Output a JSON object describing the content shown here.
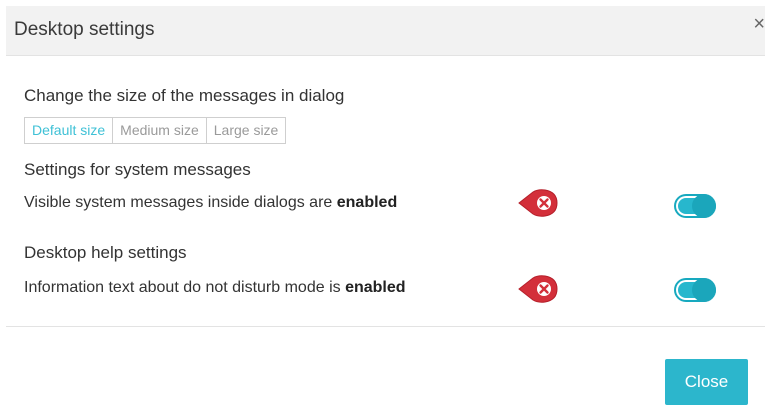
{
  "dialog": {
    "title": "Desktop settings",
    "close_icon_glyph": "×"
  },
  "message_size": {
    "title": "Change the size of the messages in dialog",
    "options": [
      "Default size",
      "Medium size",
      "Large size"
    ],
    "selected": "Default size"
  },
  "system_messages": {
    "title": "Settings for system messages",
    "text_prefix": "Visible system messages inside dialogs are",
    "text_state": "enabled",
    "toggle_on": true
  },
  "help_settings": {
    "title": "Desktop help settings",
    "text_prefix": "Information text about do not disturb mode is",
    "text_state": "enabled",
    "toggle_on": true
  },
  "footer": {
    "close_label": "Close"
  },
  "colors": {
    "accent": "#2cb6cc",
    "marker": "#d32f3a"
  }
}
